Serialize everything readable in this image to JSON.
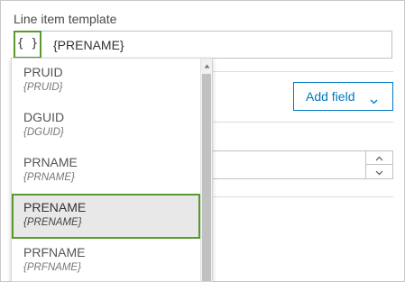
{
  "field": {
    "label": "Line item template",
    "brace_icon_text": "{ }",
    "value": "{PRENAME}"
  },
  "add_field": {
    "label": "Add field",
    "icon": "chevron-down-icon"
  },
  "stepper": {
    "up_icon": "chevron-up-icon",
    "down_icon": "chevron-down-icon"
  },
  "dropdown": {
    "items": [
      {
        "name": "PRUID",
        "token": "{PRUID}"
      },
      {
        "name": "DGUID",
        "token": "{DGUID}"
      },
      {
        "name": "PRNAME",
        "token": "{PRNAME}"
      },
      {
        "name": "PRENAME",
        "token": "{PRENAME}"
      },
      {
        "name": "PRFNAME",
        "token": "{PRFNAME}"
      }
    ],
    "selected_index": 3
  },
  "colors": {
    "highlight_border": "#5a9a2c",
    "accent": "#0079c1",
    "selected_bg": "#e8e8e8"
  }
}
